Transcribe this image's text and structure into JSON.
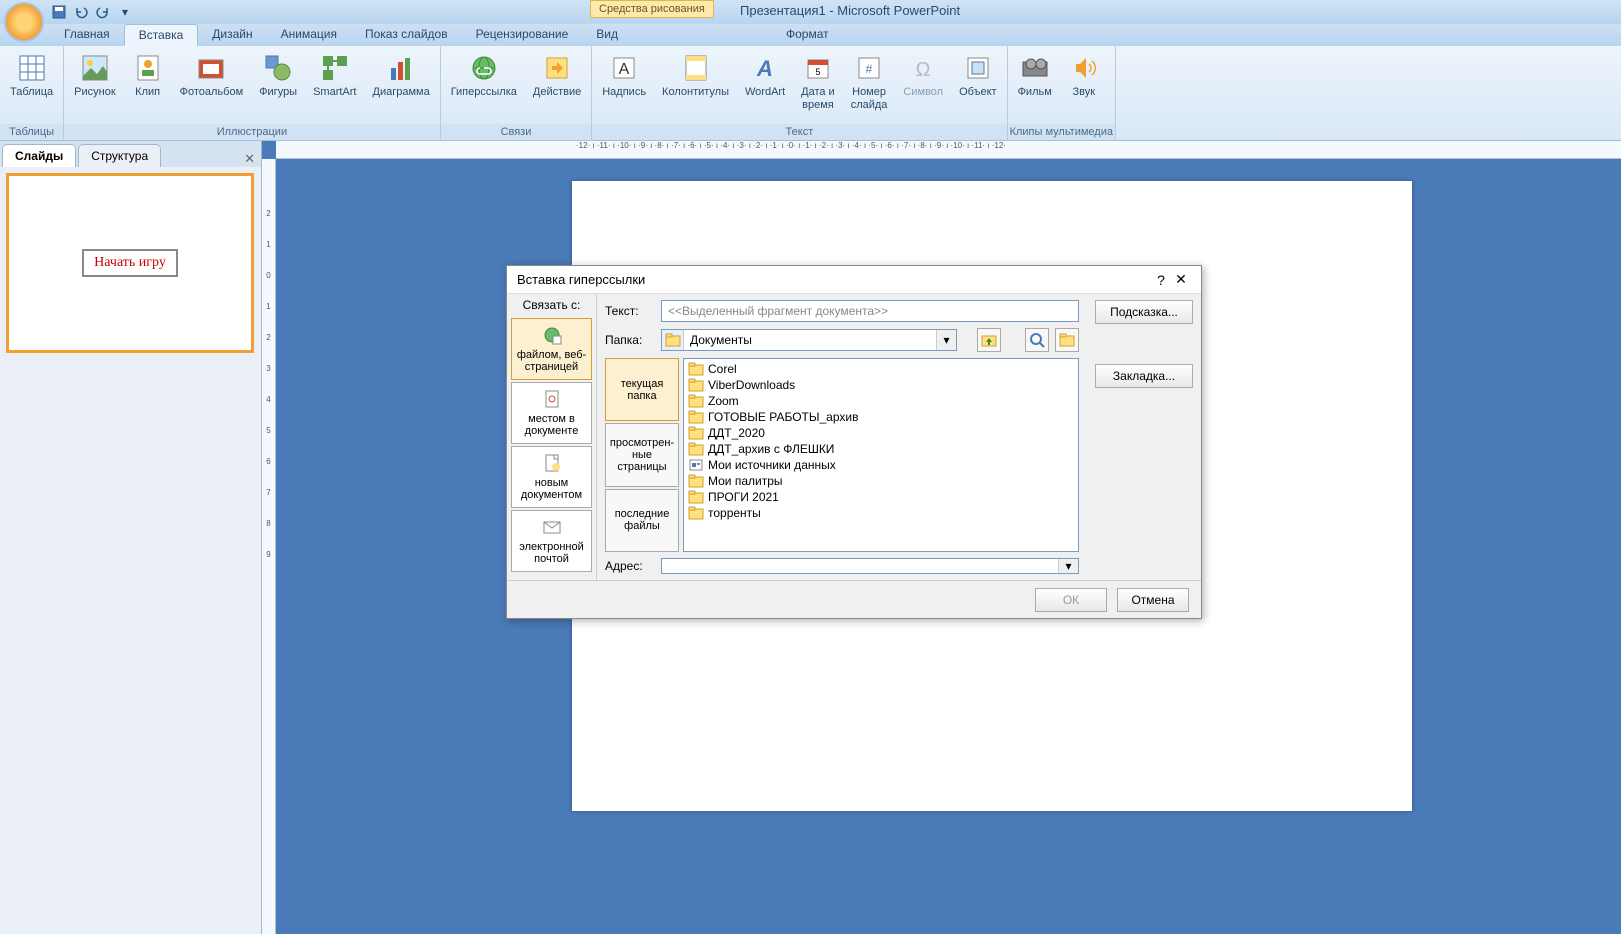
{
  "title": {
    "context_tab": "Средства рисования",
    "app": "Презентация1 - Microsoft PowerPoint"
  },
  "tabs": {
    "t0": "Главная",
    "t1": "Вставка",
    "t2": "Дизайн",
    "t3": "Анимация",
    "t4": "Показ слайдов",
    "t5": "Рецензирование",
    "t6": "Вид",
    "t7": "Формат"
  },
  "ribbon": {
    "tables": {
      "label": "Таблицы",
      "table": "Таблица"
    },
    "illus": {
      "label": "Иллюстрации",
      "pic": "Рисунок",
      "clip": "Клип",
      "album": "Фотоальбом",
      "shapes": "Фигуры",
      "smartart": "SmartArt",
      "chart": "Диаграмма"
    },
    "links": {
      "label": "Связи",
      "hyper": "Гиперссылка",
      "action": "Действие"
    },
    "text": {
      "label": "Текст",
      "textbox": "Надпись",
      "header": "Колонтитулы",
      "wordart": "WordArt",
      "date": "Дата и\nвремя",
      "slidenum": "Номер\nслайда",
      "symbol": "Символ",
      "object": "Объект"
    },
    "media": {
      "label": "Клипы мультимедиа",
      "movie": "Фильм",
      "sound": "Звук"
    }
  },
  "pane": {
    "slides": "Слайды",
    "outline": "Структура",
    "thumb_text": "Начать  игру"
  },
  "ruler_h": "·12· ı ·11· ı ·10· ı ·9· ı ·8· ı ·7· ı ·6· ı ·5· ı ·4· ı ·3· ı ·2· ı ·1· ı ·0· ı ·1· ı ·2· ı ·3· ı ·4· ı ·5· ı ·6· ı ·7· ı ·8· ı ·9· ı ·10· ı ·11· ı ·12·",
  "ruler_v": [
    "2",
    "1",
    "0",
    "1",
    "2",
    "3",
    "4",
    "5",
    "6",
    "7",
    "8",
    "9"
  ],
  "dialog": {
    "title": "Вставка гиперссылки",
    "link_to": "Связать с:",
    "opts": {
      "file": "файлом, веб-\nстраницей",
      "place": "местом в\nдокументе",
      "newdoc": "новым\nдокументом",
      "email": "электронной\nпочтой"
    },
    "text_label": "Текст:",
    "text_ph": "<<Выделенный фрагмент документа>>",
    "folder_label": "Папка:",
    "folder_val": "Документы",
    "nav": {
      "current": "текущая\nпапка",
      "visited": "просмотрен-\nные\nстраницы",
      "recent": "последние\nфайлы"
    },
    "files": [
      "Corel",
      "ViberDownloads",
      "Zoom",
      "ГОТОВЫЕ РАБОТЫ_архив",
      "ДДТ_2020",
      "ДДТ_архив с ФЛЕШКИ",
      "Мои источники данных",
      "Мои палитры",
      "ПРОГИ 2021",
      "торренты"
    ],
    "addr_label": "Адрес:",
    "tip": "Подсказка...",
    "bookmark": "Закладка...",
    "ok": "ОК",
    "cancel": "Отмена"
  }
}
